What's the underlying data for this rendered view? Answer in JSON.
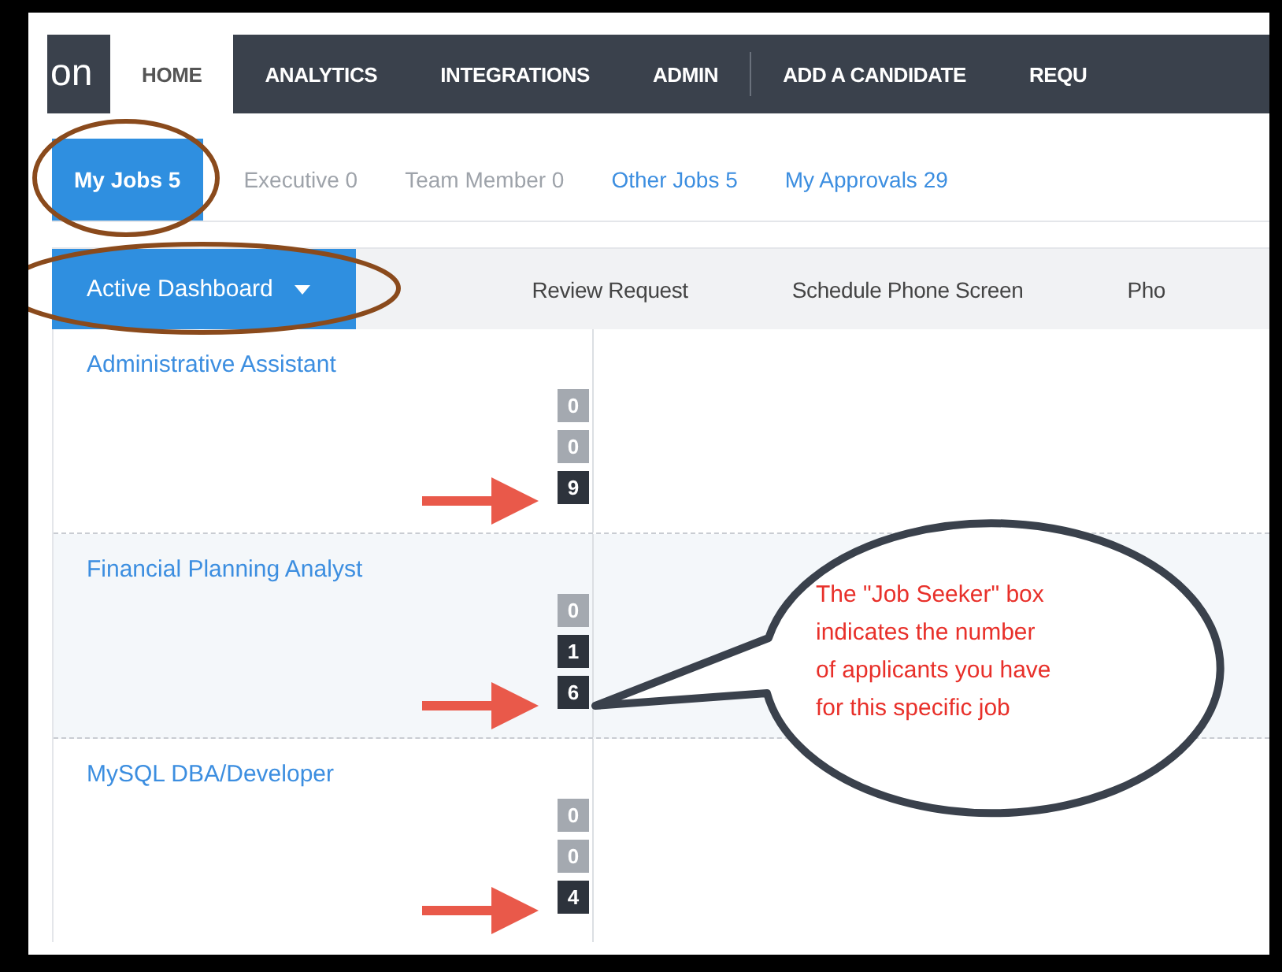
{
  "logo": {
    "text": "on"
  },
  "nav_tabs": [
    {
      "label": "HOME",
      "selected": true
    },
    {
      "label": "ANALYTICS",
      "selected": false
    },
    {
      "label": "INTEGRATIONS",
      "selected": false
    },
    {
      "label": "ADMIN",
      "selected": false
    },
    {
      "label": "ADD A CANDIDATE",
      "selected": false
    },
    {
      "label": "REQU",
      "selected": false
    }
  ],
  "filter_tabs": [
    {
      "label": "My Jobs 5",
      "selected": true,
      "disabled": false
    },
    {
      "label": "Executive 0",
      "selected": false,
      "disabled": true
    },
    {
      "label": "Team Member 0",
      "selected": false,
      "disabled": true
    },
    {
      "label": "Other Jobs 5",
      "selected": false,
      "disabled": false
    },
    {
      "label": "My Approvals 29",
      "selected": false,
      "disabled": false
    }
  ],
  "toolbar": {
    "dropdown": "Active Dashboard",
    "columns": [
      "Review Request",
      "Schedule Phone Screen",
      "Pho"
    ]
  },
  "jobs": [
    {
      "title": "Administrative Assistant",
      "counts": [
        {
          "value": "0",
          "highlighted": false
        },
        {
          "value": "0",
          "highlighted": false
        },
        {
          "value": "9",
          "highlighted": true
        }
      ]
    },
    {
      "title": "Financial Planning Analyst",
      "counts": [
        {
          "value": "0",
          "highlighted": false
        },
        {
          "value": "1",
          "highlighted": true
        },
        {
          "value": "6",
          "highlighted": true
        }
      ]
    },
    {
      "title": "MySQL DBA/Developer",
      "counts": [
        {
          "value": "0",
          "highlighted": false
        },
        {
          "value": "0",
          "highlighted": false
        },
        {
          "value": "4",
          "highlighted": true
        }
      ]
    }
  ],
  "callout": {
    "text": "The \"Job Seeker\" box indicates the number of applicants you have for this specific job"
  }
}
